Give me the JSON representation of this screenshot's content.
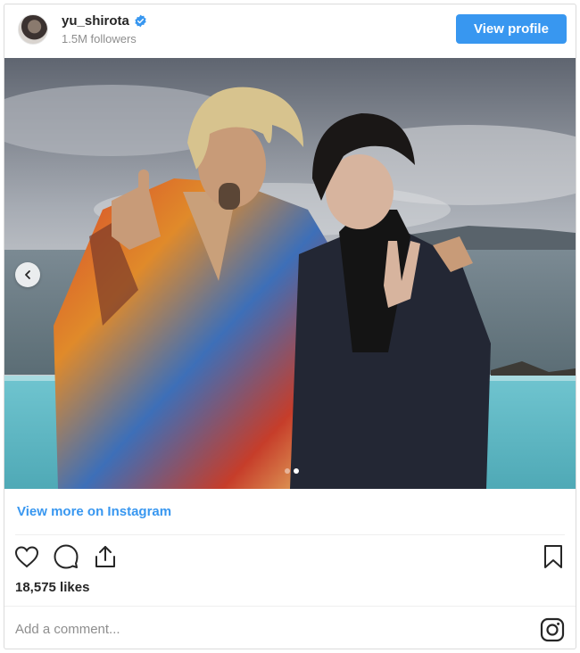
{
  "header": {
    "username": "yu_shirota",
    "followers": "1.5M followers",
    "view_profile_label": "View profile",
    "verified_icon": "verified-badge-icon"
  },
  "post": {
    "carousel": {
      "total_slides": 2,
      "active_slide": 2
    },
    "view_more_label": "View more on Instagram",
    "likes": "18,575 likes"
  },
  "actions": {
    "icons": [
      "heart-icon",
      "comment-icon",
      "share-icon",
      "bookmark-icon"
    ]
  },
  "comment": {
    "placeholder": "Add a comment..."
  },
  "colors": {
    "accent": "#3897f0",
    "text": "#262626",
    "muted": "#8e8e8e",
    "border": "#dbdbdb"
  }
}
